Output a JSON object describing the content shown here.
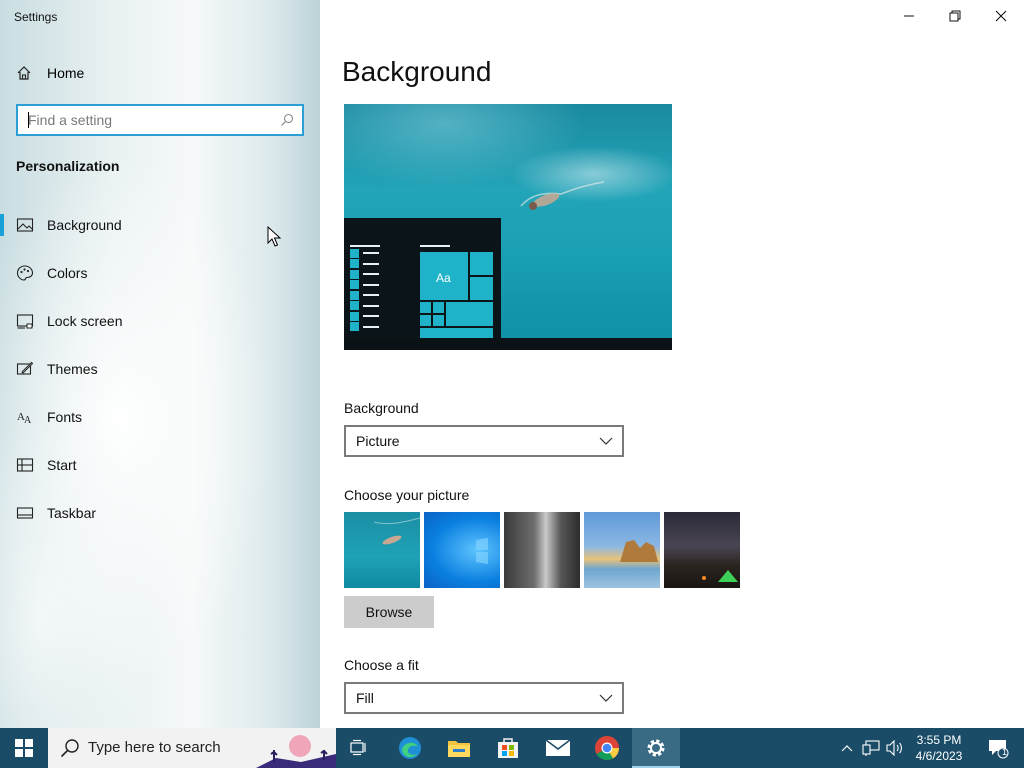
{
  "window": {
    "title": "Settings"
  },
  "sidebar": {
    "home_label": "Home",
    "search_placeholder": "Find a setting",
    "section_title": "Personalization",
    "items": [
      {
        "label": "Background",
        "icon": "picture-icon",
        "selected": true
      },
      {
        "label": "Colors",
        "icon": "palette-icon",
        "selected": false
      },
      {
        "label": "Lock screen",
        "icon": "lock-screen-icon",
        "selected": false
      },
      {
        "label": "Themes",
        "icon": "themes-brush-icon",
        "selected": false
      },
      {
        "label": "Fonts",
        "icon": "fonts-icon",
        "selected": false
      },
      {
        "label": "Start",
        "icon": "start-grid-icon",
        "selected": false
      },
      {
        "label": "Taskbar",
        "icon": "taskbar-icon",
        "selected": false
      }
    ]
  },
  "main": {
    "title": "Background",
    "preview": {
      "tile_text": "Aa"
    },
    "background_label": "Background",
    "background_value": "Picture",
    "choose_picture_label": "Choose your picture",
    "browse_label": "Browse",
    "fit_label": "Choose a fit",
    "fit_value": "Fill"
  },
  "taskbar": {
    "search_placeholder": "Type here to search",
    "time": "3:55 PM",
    "date": "4/6/2023",
    "notification_count": "1",
    "apps": [
      "task-view-icon",
      "edge-icon",
      "file-explorer-icon",
      "microsoft-store-icon",
      "mail-icon",
      "chrome-icon",
      "settings-icon"
    ]
  },
  "colors": {
    "accent": "#1aa0d8",
    "taskbar": "#1a4b67",
    "tile": "#1fb3c9"
  }
}
